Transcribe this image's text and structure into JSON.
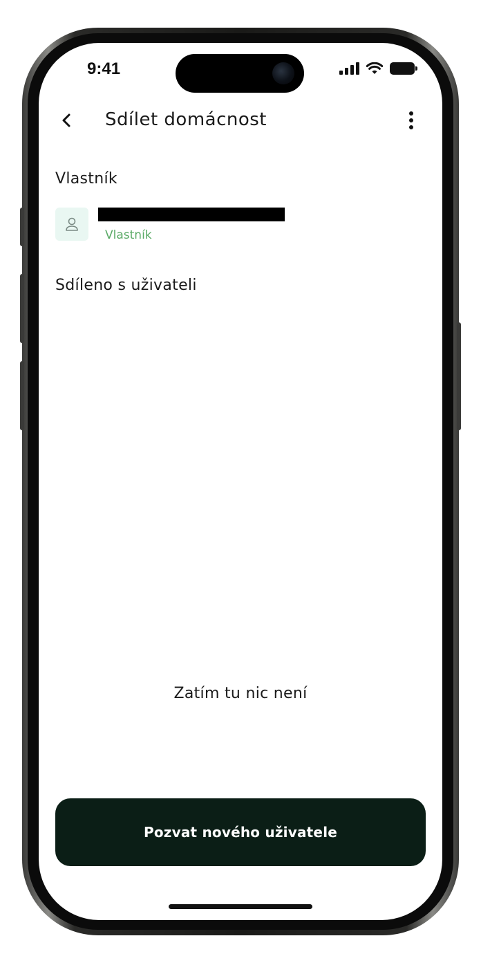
{
  "status_bar": {
    "time": "9:41",
    "icons": [
      "signal-icon",
      "wifi-icon",
      "battery-icon"
    ]
  },
  "header": {
    "back_icon": "chevron-left-icon",
    "title": "Sdílet domácnost",
    "more_icon": "more-vertical-icon"
  },
  "owner_section": {
    "heading": "Vlastník",
    "owner": {
      "avatar_icon": "user-icon",
      "name": "",
      "role": "Vlastník"
    }
  },
  "shared_section": {
    "heading": "Sdíleno s uživateli",
    "empty_text": "Zatím tu nic není"
  },
  "actions": {
    "invite_label": "Pozvat nového uživatele"
  },
  "colors": {
    "primary_button": "#0b1e16",
    "role_green": "#5aaa66",
    "avatar_bg": "#e9f7f2"
  }
}
